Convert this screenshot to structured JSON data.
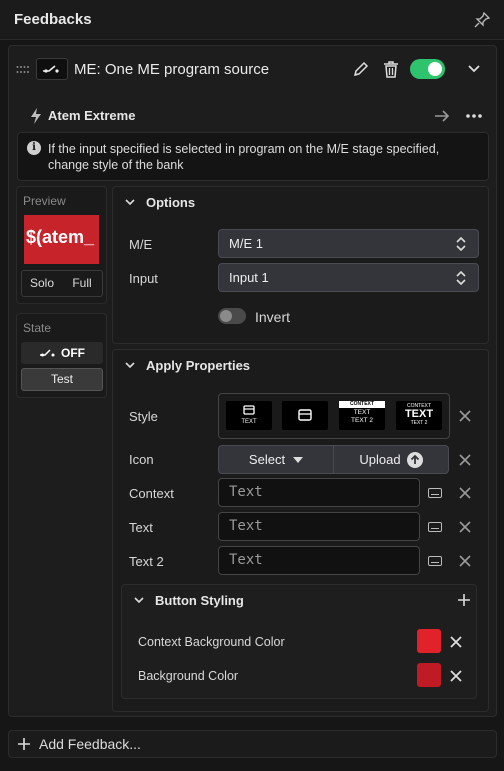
{
  "panel": {
    "title": "Feedbacks"
  },
  "feedback": {
    "title": "ME: One ME program source",
    "enabled": true,
    "connection": "Atem Extreme",
    "description": "If the input specified is selected in program on the M/E stage specified, change style of the bank"
  },
  "preview": {
    "label": "Preview",
    "button_text": "$(atem_",
    "solo": "Solo",
    "full": "Full",
    "color": "#c6232b"
  },
  "state": {
    "label": "State",
    "off": "OFF",
    "test": "Test"
  },
  "options": {
    "title": "Options",
    "me_label": "M/E",
    "me_value": "M/E 1",
    "input_label": "Input",
    "input_value": "Input 1",
    "invert_label": "Invert"
  },
  "apply": {
    "title": "Apply Properties",
    "style_label": "Style",
    "icon_label": "Icon",
    "select_label": "Select",
    "upload_label": "Upload",
    "context_label": "Context",
    "context_placeholder": "Text",
    "text_label": "Text",
    "text_placeholder": "Text",
    "text2_label": "Text 2",
    "text2_placeholder": "Text",
    "swatches": {
      "s1": "TEXT",
      "s3_ctx": "CONTEXT",
      "s3_t1": "TEXT",
      "s3_t2": "TEXT 2",
      "s4_ctx": "CONTEXT",
      "s4_t1": "TEXT",
      "s4_t2": "TEXT 2"
    }
  },
  "styling": {
    "title": "Button Styling",
    "ctx_bg_label": "Context Background Color",
    "ctx_bg_color": "#e2222b",
    "bg_label": "Background Color",
    "bg_color": "#c01a25"
  },
  "footer": {
    "add_label": "Add Feedback..."
  }
}
